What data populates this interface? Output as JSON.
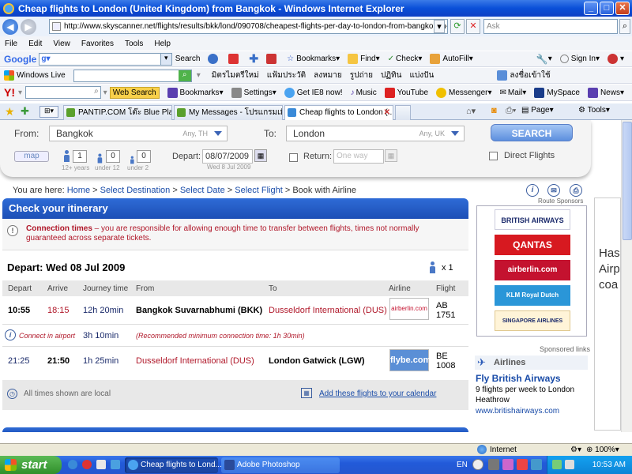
{
  "window": {
    "title": "Cheap flights to London (United Kingdom) from Bangkok - Windows Internet Explorer"
  },
  "browser": {
    "url": "http://www.skyscanner.net/flights/results/bkk/lond/090708/cheapest-flights-per-day-to-london-from-bangkok-in-July-2009",
    "search_placeholder": "Ask",
    "menu": [
      "File",
      "Edit",
      "View",
      "Favorites",
      "Tools",
      "Help"
    ],
    "google_toolbar": {
      "search_label": "Search",
      "bookmarks": "Bookmarks",
      "find": "Find",
      "check": "Check",
      "autofill": "AutoFill",
      "sign_in": "Sign In"
    },
    "wl_toolbar": {
      "label": "Windows Live",
      "links": [
        "มิตรไมตรีใหม่",
        "แฟ้มประวัติ",
        "ลงหมาย",
        "รูปถ่าย",
        "ปฏิทิน",
        "แบ่งปัน"
      ],
      "signin": "ลงชื่อเข้าใช้"
    },
    "yahoo_toolbar": {
      "web_search": "Web Search",
      "bookmarks": "Bookmarks",
      "settings": "Settings",
      "get_ie8": "Get IE8 now!",
      "music": "Music",
      "youtube": "YouTube",
      "messenger": "Messenger",
      "mail": "Mail",
      "myspace": "MySpace",
      "news": "News"
    },
    "tabs": [
      {
        "label": "PANTIP.COM โต๊ะ Blue Planet..."
      },
      {
        "label": "My Messages - โปรแกรมเมื่อส..."
      },
      {
        "label": "Cheap flights to London (..."
      }
    ],
    "cmdbar": {
      "page": "Page",
      "tools": "Tools"
    },
    "status": {
      "zone": "Internet",
      "zoom": "100%"
    }
  },
  "search": {
    "from_label": "From:",
    "from_value": "Bangkok",
    "from_hint": "Any, TH",
    "to_label": "To:",
    "to_value": "London",
    "to_hint": "Any, UK",
    "button": "SEARCH",
    "map": "map",
    "adults": "1",
    "adults_sub": "12+ years",
    "children": "0",
    "children_sub": "under 12",
    "infants": "0",
    "infants_sub": "under 2",
    "depart_label": "Depart:",
    "depart_value": "08/07/2009",
    "depart_sub": "Wed 8 Jul 2009",
    "return_label": "Return:",
    "return_placeholder": "One way",
    "direct": "Direct Flights"
  },
  "breadcrumb": {
    "prefix": "You are here:",
    "items": [
      "Home",
      "Select Destination",
      "Select Date",
      "Select Flight"
    ],
    "current": "Book with Airline"
  },
  "itinerary": {
    "header": "Check your itinerary",
    "warn_title": "Connection times",
    "warn_text": " – you are responsible for allowing enough time to transfer between flights, times not normally guaranteed across separate tickets.",
    "depart_title": "Depart: Wed 08 Jul 2009",
    "pax": "x 1",
    "columns": [
      "Depart",
      "Arrive",
      "Journey time",
      "From",
      "To",
      "Airline",
      "Flight"
    ],
    "flights": [
      {
        "depart": "10:55",
        "arrive": "18:15",
        "journey": "12h 20min",
        "from": "Bangkok Suvarnabhumi (BKK)",
        "to": "Dusseldorf International (DUS)",
        "airline": "airberlin.com",
        "flight_code": "AB",
        "flight_num": "1751"
      },
      {
        "depart": "21:25",
        "arrive": "21:50",
        "journey": "1h 25min",
        "from": "Dusseldorf International (DUS)",
        "to": "London Gatwick (LGW)",
        "airline": "flybe.com",
        "flight_code": "BE",
        "flight_num": "1008"
      }
    ],
    "connect_label": "Connect in airport",
    "connect_time": "3h 10min",
    "connect_note": "(Recommended minimum connection time: 1h 30min)",
    "footer_note": "All times shown are local",
    "calendar_link": "Add these flights to your calendar"
  },
  "sponsors": {
    "title": "Route Sponsors",
    "logos": [
      "BRITISH AIRWAYS",
      "QANTAS",
      "airberlin.com",
      "KLM Royal Dutch Airlines",
      "SINGAPORE AIRLINES"
    ]
  },
  "ad": {
    "sponsored": "Sponsored links",
    "header": "Airlines",
    "title": "Fly British Airways",
    "body": "9 flights per week to London Heathrow",
    "url": "www.britishairways.com"
  },
  "right_ad": {
    "text": "Has Airp coa"
  },
  "taskbar": {
    "start": "start",
    "tasks": [
      "Cheap flights to Lond...",
      "Adobe Photoshop"
    ],
    "lang": "EN",
    "clock": "10:53 AM"
  },
  "colors": {
    "accent": "#1d4fb6",
    "warn": "#b0182a",
    "link": "#1a4ca8"
  }
}
